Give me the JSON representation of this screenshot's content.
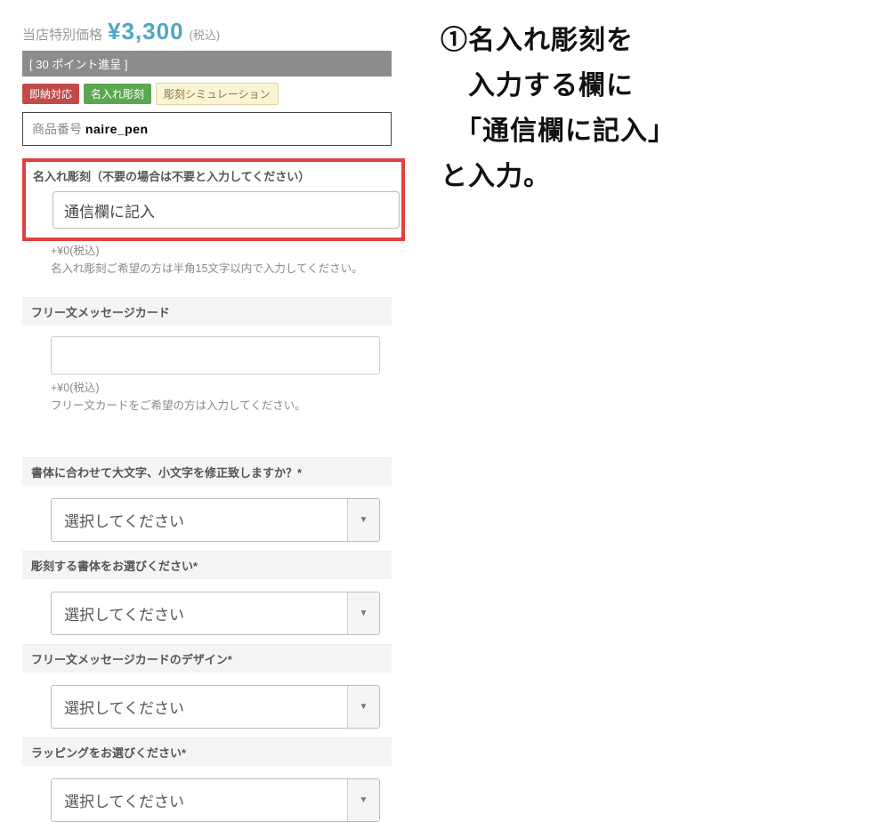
{
  "price": {
    "label": "当店特別価格",
    "value": "¥3,300",
    "tax": "(税込)"
  },
  "points_bar": "[ 30 ポイント進呈 ]",
  "tags": {
    "quick": "即納対応",
    "engrave": "名入れ彫刻",
    "sim": "彫刻シミュレーション"
  },
  "sku": {
    "label": "商品番号 ",
    "value": "naire_pen"
  },
  "engraving": {
    "label": "名入れ彫刻（不要の場合は不要と入力してください）",
    "value": "通信欄に記入",
    "price_add_truncated": "+¥0(税込)",
    "help": "名入れ彫刻ご希望の方は半角15文字以内で入力してください。"
  },
  "message_card": {
    "label": "フリー文メッセージカード",
    "value": "",
    "price_add": "+¥0(税込)",
    "help": "フリー文カードをご希望の方は入力してください。"
  },
  "selects": {
    "case_label": "書体に合わせて大文字、小文字を修正致しますか？*",
    "font_label": "彫刻する書体をお選びください*",
    "card_design_label": "フリー文メッセージカードのデザイン*",
    "wrapping_label": "ラッピングをお選びください*",
    "placeholder": "選択してください"
  },
  "instruction": {
    "line1": "①名入れ彫刻を",
    "line2": "　入力する欄に",
    "line3": "　「通信欄に記入」",
    "line4": "と入力。"
  }
}
